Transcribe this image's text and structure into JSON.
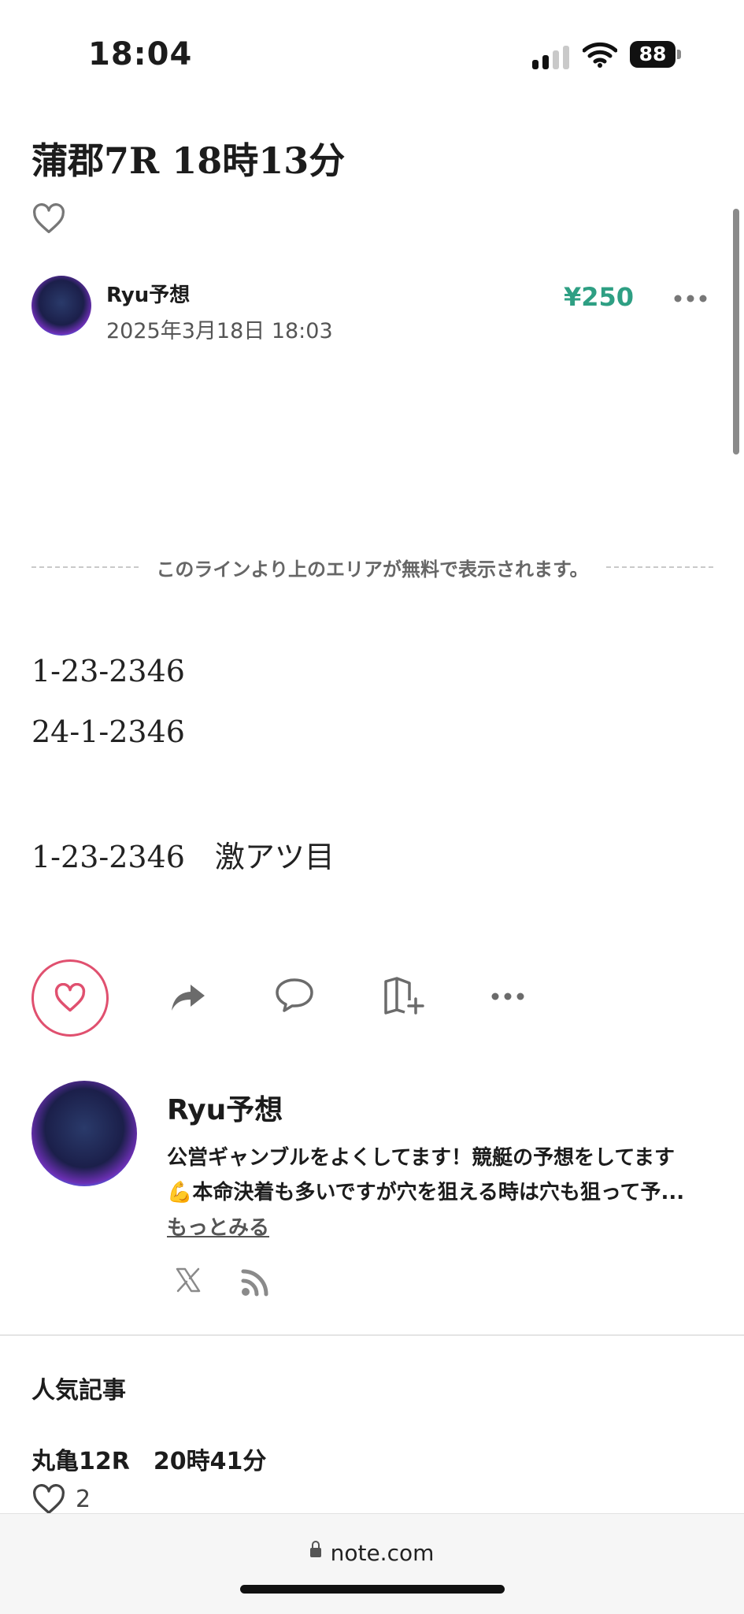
{
  "status_bar": {
    "time": "18:04",
    "battery": "88"
  },
  "article": {
    "title": "蒲郡7R 18時13分",
    "author": "Ryu予想",
    "date": "2025年3月18日 18:03",
    "price": "¥250"
  },
  "paywall": {
    "notice": "このラインより上のエリアが無料で表示されます。"
  },
  "content": {
    "lines": [
      "1-23-2346",
      "24-1-2346",
      "1-23-2346　激アツ目"
    ]
  },
  "creator": {
    "name": "Ryu予想",
    "bio_line1": "公営ギャンブルをよくしてます！競艇の予想をしてます",
    "bio_line2": "💪本命決着も多いですが穴を狙える時は穴も狙って予...",
    "more_label": "もっとみる"
  },
  "popular": {
    "heading": "人気記事",
    "items": [
      {
        "title": "丸亀12R　20時41分",
        "likes": "2"
      }
    ]
  },
  "browser": {
    "url": "note.com"
  },
  "colors": {
    "accent_green": "#2e9f83",
    "like_pink": "#e0506f"
  },
  "icons": [
    "heart-icon",
    "share-icon",
    "comment-icon",
    "magazine-add-icon",
    "more-dots-icon",
    "x-icon",
    "rss-icon",
    "lock-icon"
  ]
}
